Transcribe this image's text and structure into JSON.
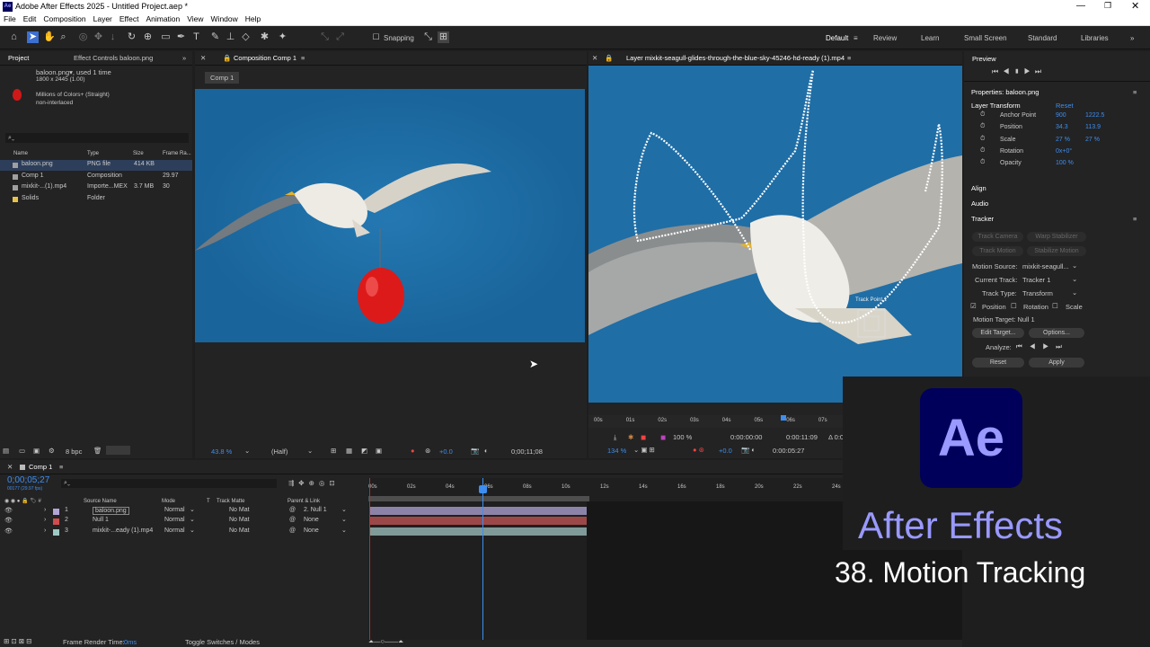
{
  "app": {
    "title": "Adobe After Effects 2025 - Untitled Project.aep *",
    "logo": "Ae"
  },
  "menu": [
    "File",
    "Edit",
    "Composition",
    "Layer",
    "Effect",
    "Animation",
    "View",
    "Window",
    "Help"
  ],
  "toolbar": {
    "snapping": "Snapping"
  },
  "workspaces": [
    "Default",
    "Review",
    "Learn",
    "Small Screen",
    "Standard",
    "Libraries"
  ],
  "project": {
    "tab": "Project",
    "effect_tab": "Effect Controls baloon.png",
    "info_name": "baloon.png▾, used 1 time",
    "info_dims": "1800 x 2445 (1.00)",
    "info_color": "Millions of Colors+ (Straight)",
    "info_interlace": "non-interlaced",
    "columns": [
      "Name",
      "Type",
      "Size",
      "Frame Ra..."
    ],
    "items": [
      {
        "name": "baloon.png",
        "type": "PNG file",
        "size": "414 KB",
        "fps": "",
        "color": "#a0a0a0"
      },
      {
        "name": "Comp 1",
        "type": "Composition",
        "size": "",
        "fps": "29.97",
        "color": "#a0a0a0"
      },
      {
        "name": "mixkit-...(1).mp4",
        "type": "Importe...MEX",
        "size": "3.7 MB",
        "fps": "30",
        "color": "#a0a0a0"
      },
      {
        "name": "Solids",
        "type": "Folder",
        "size": "",
        "fps": "",
        "color": "#e6c34a"
      }
    ],
    "bpc": "8 bpc"
  },
  "comp": {
    "tab": "Composition Comp 1",
    "subtab": "Comp 1",
    "zoom": "43.8 %",
    "res": "(Half)",
    "exposure": "+0.0",
    "time": "0;00;11;08"
  },
  "layer_viewer": {
    "tab": "Layer mixkit-seagull-glides-through-the-blue-sky-45246-hd-ready (1).mp4",
    "ruler": [
      "00s",
      "01s",
      "02s",
      "03s",
      "04s",
      "05s",
      "06s",
      "07s"
    ],
    "zoom": "134 %",
    "pct": "100 %",
    "t_in": "0:00:00:00",
    "t_out": "0:00:11:09",
    "t_delta": "Δ 0:0",
    "t_cur": "0:00:05:27",
    "exposure": "+0.0",
    "track_point": "Track Point 1"
  },
  "preview": {
    "tab": "Preview"
  },
  "properties": {
    "title": "Properties: baloon.png",
    "section": "Layer Transform",
    "reset": "Reset",
    "rows": [
      {
        "label": "Anchor Point",
        "v1": "900",
        "v2": "1222.5"
      },
      {
        "label": "Position",
        "v1": "34.3",
        "v2": "113.9"
      },
      {
        "label": "Scale",
        "v1": "27 %",
        "v2": "27 %"
      },
      {
        "label": "Rotation",
        "v1": "0x+0°",
        "v2": ""
      },
      {
        "label": "Opacity",
        "v1": "100 %",
        "v2": ""
      }
    ]
  },
  "align": "Align",
  "audio": "Audio",
  "tracker": {
    "title": "Tracker",
    "track_camera": "Track Camera",
    "warp": "Warp Stabilizer",
    "track_motion": "Track Motion",
    "stabilize": "Stabilize Motion",
    "motion_source_label": "Motion Source:",
    "motion_source": "mixkit-seagull...",
    "current_track_label": "Current Track:",
    "current_track": "Tracker 1",
    "track_type_label": "Track Type:",
    "track_type": "Transform",
    "position": "Position",
    "rotation": "Rotation",
    "scale": "Scale",
    "motion_target": "Motion Target: Null 1",
    "edit_target": "Edit Target...",
    "options": "Options...",
    "analyze": "Analyze:",
    "reset": "Reset",
    "apply": "Apply"
  },
  "timeline": {
    "tab": "Comp 1",
    "timecode": "0;00;05;27",
    "sub_timecode": "00177 (29.97 fps)",
    "columns": {
      "source": "Source Name",
      "mode": "Mode",
      "t": "T",
      "matte": "Track Matte",
      "parent": "Parent & Link"
    },
    "ruler": [
      "00s",
      "02s",
      "04s",
      "06s",
      "08s",
      "10s",
      "12s",
      "14s",
      "16s",
      "18s",
      "20s",
      "22s",
      "24s"
    ],
    "layers": [
      {
        "num": "1",
        "name": "baloon.png",
        "mode": "Normal",
        "matte": "No Mat",
        "parent": "2. Null 1",
        "color": "#b3a4d6",
        "bar": "#8c84a8"
      },
      {
        "num": "2",
        "name": "Null 1",
        "mode": "Normal",
        "matte": "No Mat",
        "parent": "None",
        "color": "#d14c4c",
        "bar": "#9c4848"
      },
      {
        "num": "3",
        "name": "mixkit-...eady (1).mp4",
        "mode": "Normal",
        "matte": "No Mat",
        "parent": "None",
        "color": "#9fc9c4",
        "bar": "#7f9a99"
      }
    ],
    "frame_render": "Frame Render Time:",
    "frame_render_val": "0ms",
    "toggle": "Toggle Switches / Modes"
  },
  "overlay": {
    "brand": "After Effects",
    "lesson": "38. Motion Tracking"
  },
  "colors": {
    "accent": "#3d8ef0",
    "ae_bg": "#00005b",
    "ae_fg": "#9999ff",
    "sky": "#1d6da6"
  }
}
